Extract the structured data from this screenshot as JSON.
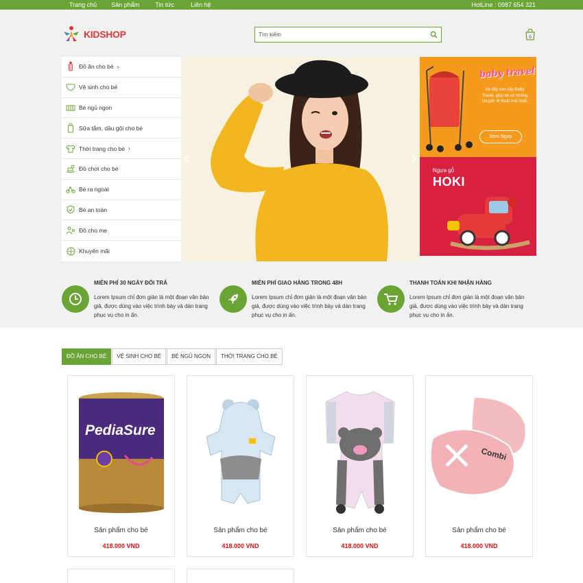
{
  "topbar": {
    "nav": [
      "Trang chủ",
      "Sản phẩm",
      "Tin tức",
      "Liên hệ"
    ],
    "hotline": "HotLine : 0987 654 321"
  },
  "header": {
    "logo_text": "KIDSHOP",
    "search_placeholder": "Tìm kiếm",
    "cart_count": "0"
  },
  "sidebar": {
    "items": [
      {
        "label": "Đồ ăn cho bé",
        "icon": "bottle-icon",
        "arrow": "›"
      },
      {
        "label": "Vệ sinh cho bé",
        "icon": "diaper-icon",
        "arrow": ""
      },
      {
        "label": "Bé ngủ ngon",
        "icon": "crib-icon",
        "arrow": ""
      },
      {
        "label": "Sữa tắm, dầu gội cho bé",
        "icon": "shampoo-icon",
        "arrow": ""
      },
      {
        "label": "Thời trang cho bé",
        "icon": "shirt-icon",
        "arrow": "›"
      },
      {
        "label": "Đồ chơi cho bé",
        "icon": "rocking-horse-icon",
        "arrow": ""
      },
      {
        "label": "Bé ra ngoài",
        "icon": "tricycle-icon",
        "arrow": ""
      },
      {
        "label": "Bé an toàn",
        "icon": "shield-icon",
        "arrow": ""
      },
      {
        "label": "Đồ cho mẹ",
        "icon": "mother-icon",
        "arrow": ""
      },
      {
        "label": "Khuyến mãi",
        "icon": "gift-icon",
        "arrow": ""
      }
    ]
  },
  "banner": {
    "prev": "‹",
    "next": "›"
  },
  "ads": {
    "ad1_brand": "baby travel",
    "ad1_text": "Xe đẩy cao cấp BaBy Travel, giúp bé có những chuyến đi thoải mái nhất.",
    "ad1_button": "Xem Ngay",
    "ad2_sub": "Ngựa gỗ",
    "ad2_title": "HOKI"
  },
  "features": [
    {
      "title": "MIỄN PHÍ 30 NGÀY ĐỔI TRẢ",
      "desc": "Lorem Ipsum chỉ đơn giản là một đoạn văn bản giả, được dùng vào việc trình bày và dàn trang phục vụ cho in ấn.",
      "icon": "clock-icon"
    },
    {
      "title": "MIỄN PHÍ GIAO HÀNG TRONG 48H",
      "desc": "Lorem Ipsum chỉ đơn giản là một đoạn văn bản giả, được dùng vào việc trình bày và dàn trang phục vụ cho in ấn.",
      "icon": "rocket-icon"
    },
    {
      "title": "THANH TOÁN KHI NHẬN HÀNG",
      "desc": "Lorem Ipsum chỉ đơn giản là một đoạn văn bản giả, được dùng vào việc trình bày và dàn trang phục vụ cho in ấn.",
      "icon": "cart-icon"
    }
  ],
  "tabs": [
    "ĐỒ ĂN CHO BÉ",
    "VỆ SINH CHO BÉ",
    "BÉ NGỦ NGON",
    "THỜI TRANG CHO BÉ"
  ],
  "products": [
    {
      "name": "Sản phẩm cho bé",
      "price": "418.000",
      "currency": "VND"
    },
    {
      "name": "Sản phẩm cho bé",
      "price": "418.000",
      "currency": "VND"
    },
    {
      "name": "Sản phẩm cho bé",
      "price": "418.000",
      "currency": "VND"
    },
    {
      "name": "Sản phẩm cho bé",
      "price": "418.000",
      "currency": "VND"
    }
  ],
  "product_images": {
    "p1_brand": "PediaSure",
    "p4_brand": "Combi"
  },
  "colors": {
    "accent": "#6aa435",
    "price": "#e01010",
    "logo": "#e03838"
  }
}
